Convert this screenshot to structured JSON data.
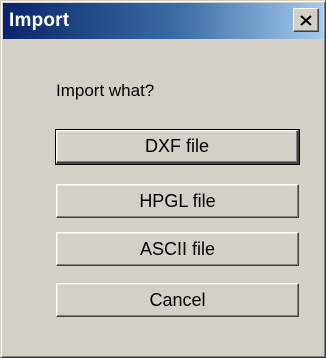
{
  "dialog": {
    "title": "Import",
    "close_icon": "close-icon",
    "prompt": "Import what?"
  },
  "buttons": {
    "dxf": "DXF file",
    "hpgl": "HPGL file",
    "ascii": "ASCII file",
    "cancel": "Cancel"
  },
  "colors": {
    "title_gradient_start": "#0a246a",
    "title_gradient_end": "#a6caf0",
    "window_face": "#d4d0c8"
  }
}
